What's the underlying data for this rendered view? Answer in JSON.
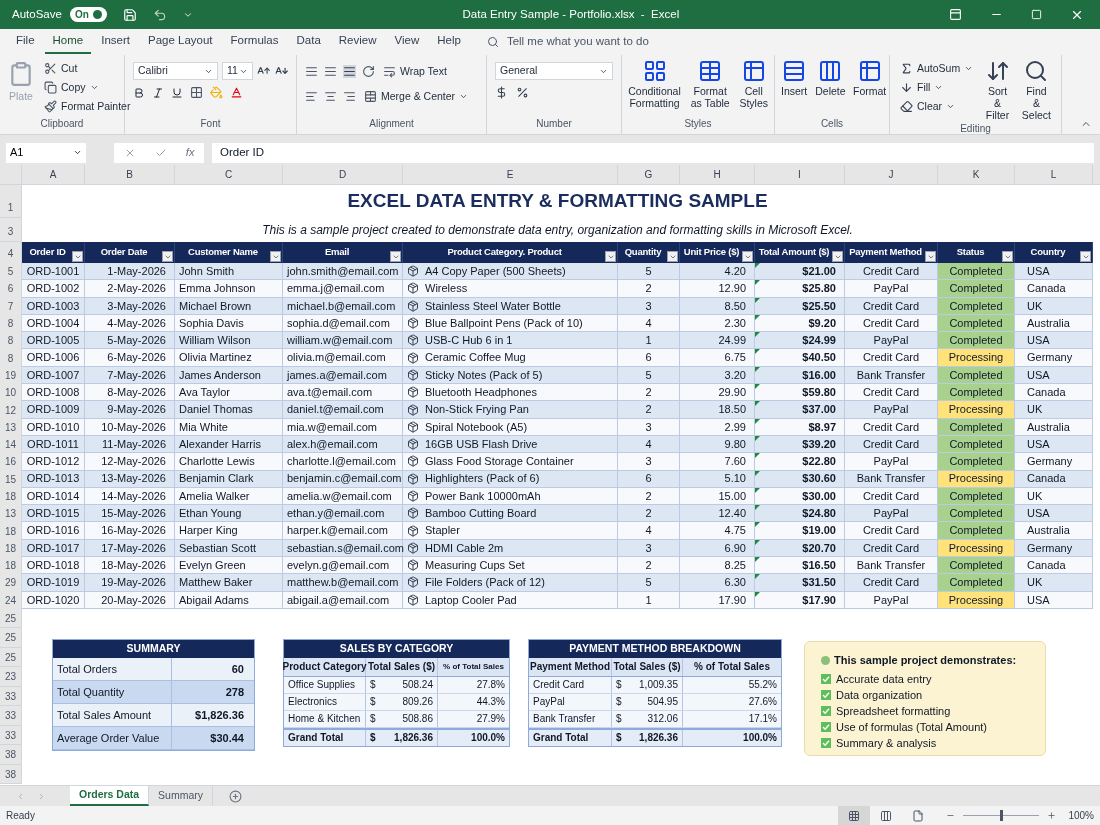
{
  "title_bar": {
    "autosave_label": "AutoSave",
    "autosave_toggle": {
      "label": "On",
      "on": true
    },
    "title": "Data Entry Sample - Portfolio.xlsx  -  Excel"
  },
  "menu_tabs": [
    {
      "label": "File",
      "selected": false
    },
    {
      "label": "Home",
      "selected": true
    },
    {
      "label": "Insert",
      "selected": false
    },
    {
      "label": "Page Layout",
      "selected": false
    },
    {
      "label": "Formulas",
      "selected": false
    },
    {
      "label": "Data",
      "selected": false
    },
    {
      "label": "Review",
      "selected": false
    },
    {
      "label": "View",
      "selected": false
    },
    {
      "label": "Help",
      "selected": false
    }
  ],
  "tell_me": {
    "placeholder": "Tell me what you want to do"
  },
  "ribbon": [
    {
      "kind": "clipboard",
      "label": "Clipboard",
      "paste": {
        "label": "Plate",
        "disabled": true
      },
      "items": [
        "Cut",
        "Copy",
        "Format Painter"
      ]
    },
    {
      "kind": "font",
      "label": "Font",
      "font_name": "Calibri",
      "font_size": "11"
    },
    {
      "kind": "alignment",
      "label": "Alignment",
      "items": [
        "Wrap Text",
        "Merge & Center"
      ]
    },
    {
      "kind": "number",
      "label": "Number",
      "format": "General"
    },
    {
      "kind": "styles",
      "label": "Styles",
      "items": [
        "Conditional Formatting",
        "Format as Table",
        "Cell Styles"
      ]
    },
    {
      "kind": "cells",
      "label": "Cells",
      "items": [
        "Insert",
        "Delete",
        "Format"
      ]
    },
    {
      "kind": "editing",
      "label": "Editing",
      "small_items": [
        "AutoSum",
        "Fill",
        "Clear"
      ],
      "large_items": [
        "Sort & Filter",
        "Find & Select"
      ]
    }
  ],
  "formula_bar": {
    "name_box": "A1",
    "fx_label": "fx",
    "value": "Order ID"
  },
  "column_letters": [
    "A",
    "B",
    "C",
    "D",
    "E",
    "G",
    "H",
    "I",
    "J",
    "K",
    "L"
  ],
  "sheet": {
    "title_row_number": "1",
    "title": "EXCEL DATA ENTRY & FORMATTING SAMPLE",
    "subtitle_row_number": "3",
    "subtitle": "This is a sample project created to demonstrate data entry, organization and formatting skills in Microsoft Excel.",
    "header_row_number": "4",
    "headers": [
      "Order ID",
      "Order Date",
      "Customer Name",
      "Email",
      "Product Category. Product",
      "Quantity",
      "Unit Price ($)",
      "Total Amount ($)",
      "Payment Method",
      "Status",
      "Country"
    ],
    "rows": [
      {
        "row_number": "5",
        "cells": [
          "ORD-1001",
          "1-May-2026",
          "John Smith",
          "john.smith@email.com",
          "A4 Copy Paper (500 Sheets)",
          "5",
          "4.20",
          "$21.00",
          "Credit Card",
          "Completed",
          "USA"
        ],
        "color": "#a9d18e"
      },
      {
        "row_number": "6",
        "cells": [
          "ORD-1002",
          "2-May-2026",
          "Emma Johnson",
          "emma.j@email.com",
          "Wireless",
          "2",
          "12.90",
          "$25.80",
          "PayPal",
          "Completed",
          "Canada"
        ],
        "color": "#a9d18e"
      },
      {
        "row_number": "7",
        "cells": [
          "ORD-1003",
          "3-May-2026",
          "Michael Brown",
          "michael.b@email.com",
          "Stainless Steel Water Bottle",
          "3",
          "8.50",
          "$25.50",
          "Credit Card",
          "Completed",
          "UK"
        ],
        "color": "#a9d18e"
      },
      {
        "row_number": "8",
        "cells": [
          "ORD-1004",
          "4-May-2026",
          "Sophia Davis",
          "sophia.d@email.com",
          "Blue Ballpoint Pens (Pack of 10)",
          "4",
          "2.30",
          "$9.20",
          "Credit Card",
          "Completed",
          "Australia"
        ],
        "color": "#a9d18e"
      },
      {
        "row_number": "8",
        "cells": [
          "ORD-1005",
          "5-May-2026",
          "William Wilson",
          "william.w@email.com",
          "USB-C Hub 6 in 1",
          "1",
          "24.99",
          "$24.99",
          "PayPal",
          "Completed",
          "USA"
        ],
        "color": "#a9d18e"
      },
      {
        "row_number": "8",
        "cells": [
          "ORD-1006",
          "6-May-2026",
          "Olivia Martinez",
          "olivia.m@email.com",
          "Ceramic Coffee Mug",
          "6",
          "6.75",
          "$40.50",
          "Credit Card",
          "Processing",
          "Germany"
        ],
        "color": "#ffe27a"
      },
      {
        "row_number": "19",
        "cells": [
          "ORD-1007",
          "7-May-2026",
          "James Anderson",
          "james.a@email.com",
          "Sticky Notes (Pack of 5)",
          "5",
          "3.20",
          "$16.00",
          "Bank Transfer",
          "Completed",
          "USA"
        ],
        "color": "#a9d18e"
      },
      {
        "row_number": "10",
        "cells": [
          "ORD-1008",
          "8-May-2026",
          "Ava Taylor",
          "ava.t@email.com",
          "Bluetooth Headphones",
          "2",
          "29.90",
          "$59.80",
          "Credit Card",
          "Completed",
          "Canada"
        ],
        "color": "#a9d18e"
      },
      {
        "row_number": "12",
        "cells": [
          "ORD-1009",
          "9-May-2026",
          "Daniel Thomas",
          "daniel.t@email.com",
          "Non-Stick Frying Pan",
          "2",
          "18.50",
          "$37.00",
          "PayPal",
          "Processing",
          "UK"
        ],
        "color": "#ffe27a"
      },
      {
        "row_number": "13",
        "cells": [
          "ORD-1010",
          "10-May-2026",
          "Mia White",
          "mia.w@email.com",
          "Spiral Notebook (A5)",
          "3",
          "2.99",
          "$8.97",
          "Credit Card",
          "Completed",
          "Australia"
        ],
        "color": "#a9d18e"
      },
      {
        "row_number": "14",
        "cells": [
          "ORD-1011",
          "11-May-2026",
          "Alexander Harris",
          "alex.h@email.com",
          "16GB USB Flash Drive",
          "4",
          "9.80",
          "$39.20",
          "Credit Card",
          "Completed",
          "USA"
        ],
        "color": "#a9d18e"
      },
      {
        "row_number": "16",
        "cells": [
          "ORD-1012",
          "12-May-2026",
          "Charlotte Lewis",
          "charlotte.l@email.com",
          "Glass Food Storage Container",
          "3",
          "7.60",
          "$22.80",
          "PayPal",
          "Completed",
          "Germany"
        ],
        "color": "#a9d18e"
      },
      {
        "row_number": "15",
        "cells": [
          "ORD-1013",
          "13-May-2026",
          "Benjamin Clark",
          "benjamin.c@email.com",
          "Highlighters (Pack of 6)",
          "6",
          "5.10",
          "$30.60",
          "Bank Transfer",
          "Processing",
          "Canada"
        ],
        "color": "#ffe27a"
      },
      {
        "row_number": "18",
        "cells": [
          "ORD-1014",
          "14-May-2026",
          "Amelia Walker",
          "amelia.w@email.com",
          "Power Bank 10000mAh",
          "2",
          "15.00",
          "$30.00",
          "Credit Card",
          "Completed",
          "UK"
        ],
        "color": "#a9d18e"
      },
      {
        "row_number": "13",
        "cells": [
          "ORD-1015",
          "15-May-2026",
          "Ethan Young",
          "ethan.y@email.com",
          "Bamboo Cutting Board",
          "2",
          "12.40",
          "$24.80",
          "PayPal",
          "Completed",
          "USA"
        ],
        "color": "#a9d18e"
      },
      {
        "row_number": "18",
        "cells": [
          "ORD-1016",
          "16-May-2026",
          "Harper King",
          "harper.k@email.com",
          "Stapler",
          "4",
          "4.75",
          "$19.00",
          "Credit Card",
          "Completed",
          "Australia"
        ],
        "color": "#a9d18e"
      },
      {
        "row_number": "18",
        "cells": [
          "ORD-1017",
          "17-May-2026",
          "Sebastian Scott",
          "sebastian.s@email.com",
          "HDMI Cable 2m",
          "3",
          "6.90",
          "$20.70",
          "Credit Card",
          "Processing",
          "Germany"
        ],
        "color": "#ffe27a"
      },
      {
        "row_number": "18",
        "cells": [
          "ORD-1018",
          "18-May-2026",
          "Evelyn Green",
          "evelyn.g@email.com",
          "Measuring Cups Set",
          "2",
          "8.25",
          "$16.50",
          "Bank Transfer",
          "Completed",
          "Canada"
        ],
        "color": "#a9d18e"
      },
      {
        "row_number": "29",
        "cells": [
          "ORD-1019",
          "19-May-2026",
          "Matthew Baker",
          "matthew.b@email.com",
          "File Folders (Pack of 12)",
          "5",
          "6.30",
          "$31.50",
          "Credit Card",
          "Completed",
          "UK"
        ],
        "color": "#a9d18e"
      },
      {
        "row_number": "24",
        "cells": [
          "ORD-1020",
          "20-May-2026",
          "Abigail Adams",
          "abigail.a@email.com",
          "Laptop Cooler Pad",
          "1",
          "17.90",
          "$17.90",
          "PayPal",
          "Processing",
          "USA"
        ],
        "color": "#ffe27a"
      }
    ],
    "lower_row_numbers": [
      "25",
      "25",
      "25",
      "23",
      "33",
      "33",
      "33",
      "38",
      "38"
    ]
  },
  "summary": {
    "title": "SUMMARY",
    "rows": [
      {
        "label": "Total Orders",
        "value": "60"
      },
      {
        "label": "Total Quantity",
        "value": "278"
      },
      {
        "label": "Total Sales Amount",
        "value": "$1,826.36"
      },
      {
        "label": "Average Order Value",
        "value": "$30.44"
      }
    ]
  },
  "sales_by_category": {
    "title": "SALES BY CATEGORY",
    "columns": [
      "Product Category",
      "Total Sales ($)",
      "% of Total Sales"
    ],
    "rows": [
      {
        "kind": "item",
        "label": "Office Supplies",
        "currency": "$",
        "amount": "508.24",
        "share": "27.8%"
      },
      {
        "kind": "item",
        "label": "Electronics",
        "currency": "$",
        "amount": "809.26",
        "share": "44.3%"
      },
      {
        "kind": "item",
        "label": "Home & Kitchen",
        "currency": "$",
        "amount": "508.86",
        "share": "27.9%"
      },
      {
        "kind": "total",
        "label": "Grand Total",
        "currency": "$",
        "amount": "1,826.36",
        "share": "100.0%"
      }
    ]
  },
  "payment_breakdown": {
    "title": "PAYMENT METHOD BREAKDOWN",
    "columns": [
      "Payment Method",
      "Total Sales ($)",
      "% of Total Sales"
    ],
    "rows": [
      {
        "kind": "item",
        "label": "Credit Card",
        "currency": "$",
        "amount": "1,009.35",
        "share": "55.2%"
      },
      {
        "kind": "item",
        "label": "PayPal",
        "currency": "$",
        "amount": "504.95",
        "share": "27.6%"
      },
      {
        "kind": "item",
        "label": "Bank Transfer",
        "currency": "$",
        "amount": "312.06",
        "share": "17.1%"
      },
      {
        "kind": "total",
        "label": "Grand Total",
        "currency": "$",
        "amount": "1,826.36",
        "share": "100.0%"
      }
    ]
  },
  "notes": {
    "heading": "This sample project demonstrates:",
    "items": [
      {
        "label": "Accurate data entry",
        "checked": true
      },
      {
        "label": "Data organization",
        "checked": true
      },
      {
        "label": "Spreadsheet formatting",
        "checked": true
      },
      {
        "label": "Use of formulas (Total Amount)",
        "checked": true
      },
      {
        "label": "Summary & analysis",
        "checked": true
      }
    ]
  },
  "sheet_tabs": [
    {
      "label": "Orders Data",
      "selected": true
    },
    {
      "label": "Summary",
      "selected": false
    }
  ],
  "status_bar": {
    "status": "Ready",
    "views": [
      {
        "selected": true
      },
      {
        "selected": false
      },
      {
        "selected": false
      }
    ],
    "zoom": {
      "level": 0.5,
      "reading": "100%"
    }
  }
}
